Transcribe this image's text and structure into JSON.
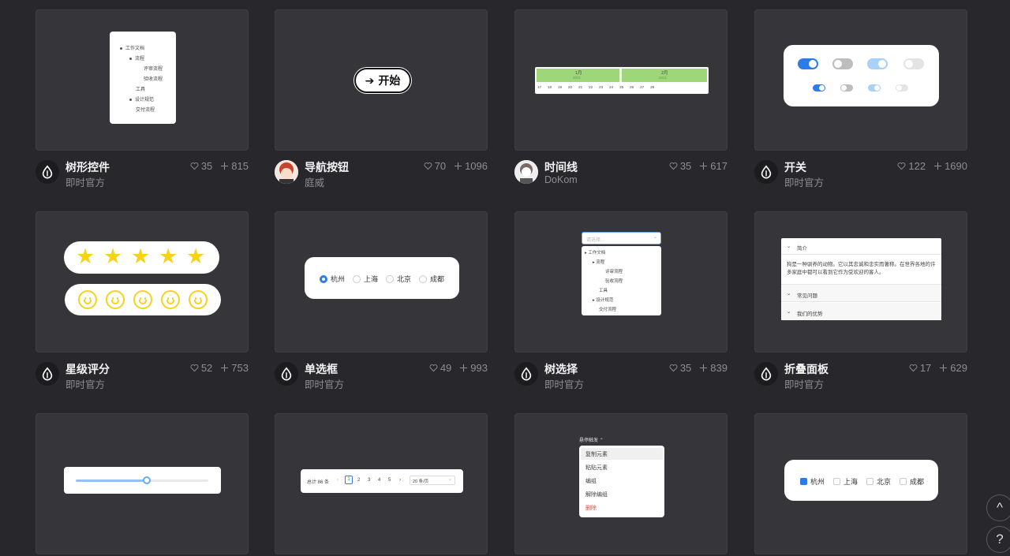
{
  "cards": [
    {
      "title": "树形控件",
      "author": "即时官方",
      "likes": "35",
      "forks": "815",
      "preview": {
        "items": [
          "工作文档",
          "流程",
          "评审流程",
          "验收流程",
          "工具",
          "设计规范",
          "交付流程"
        ]
      }
    },
    {
      "title": "导航按钮",
      "author": "庭威",
      "likes": "70",
      "forks": "1096",
      "preview": {
        "label": "开始"
      }
    },
    {
      "title": "时间线",
      "author": "DoKom",
      "likes": "35",
      "forks": "617",
      "preview": {
        "months": [
          "1月",
          "2月"
        ],
        "years": [
          "2021",
          "2021"
        ],
        "days": [
          "17",
          "18",
          "19",
          "20",
          "21",
          "22",
          "23",
          "24",
          "25",
          "26",
          "27",
          "28"
        ]
      }
    },
    {
      "title": "开关",
      "author": "即时官方",
      "likes": "122",
      "forks": "1690",
      "preview": {}
    },
    {
      "title": "星级评分",
      "author": "即时官方",
      "likes": "52",
      "forks": "753",
      "preview": {}
    },
    {
      "title": "单选框",
      "author": "即时官方",
      "likes": "49",
      "forks": "993",
      "preview": {
        "options": [
          "杭州",
          "上海",
          "北京",
          "成都"
        ]
      }
    },
    {
      "title": "树选择",
      "author": "即时官方",
      "likes": "35",
      "forks": "839",
      "preview": {
        "placeholder": "请选择...",
        "items": [
          "工作文档",
          "流程",
          "评审流程",
          "验收流程",
          "工具",
          "设计规范",
          "交付流程"
        ]
      }
    },
    {
      "title": "折叠面板",
      "author": "即时官方",
      "likes": "17",
      "forks": "629",
      "preview": {
        "panels": [
          "简介",
          "常见问题",
          "我们的优势"
        ],
        "body": "狗是一种驯养的动物。它以其忠诚和忠实而著称。在世界各地的许多家庭中都可以看到它作为受欢迎的客人。"
      }
    },
    {
      "title": "",
      "author": "",
      "likes": "",
      "forks": "",
      "preview": {}
    },
    {
      "title": "",
      "author": "",
      "likes": "",
      "forks": "",
      "preview": {
        "total": "总计 86 条",
        "pages": [
          "1",
          "2",
          "3",
          "4",
          "5"
        ],
        "page_size": "20 条/页"
      }
    },
    {
      "title": "",
      "author": "",
      "likes": "",
      "forks": "",
      "preview": {
        "trigger": "悬停触发",
        "menu": [
          "复制元素",
          "粘贴元素",
          "编组",
          "解除编组",
          "删除"
        ]
      }
    },
    {
      "title": "",
      "author": "",
      "likes": "",
      "forks": "",
      "preview": {
        "options": [
          "杭州",
          "上海",
          "北京",
          "成都"
        ]
      }
    }
  ],
  "fabs": {
    "up": "^",
    "help": "?"
  },
  "colors": {
    "accent": "#2b7ce9",
    "star": "#f7d21b",
    "timeline_green": "#9dd77a",
    "danger": "#e0463c"
  }
}
